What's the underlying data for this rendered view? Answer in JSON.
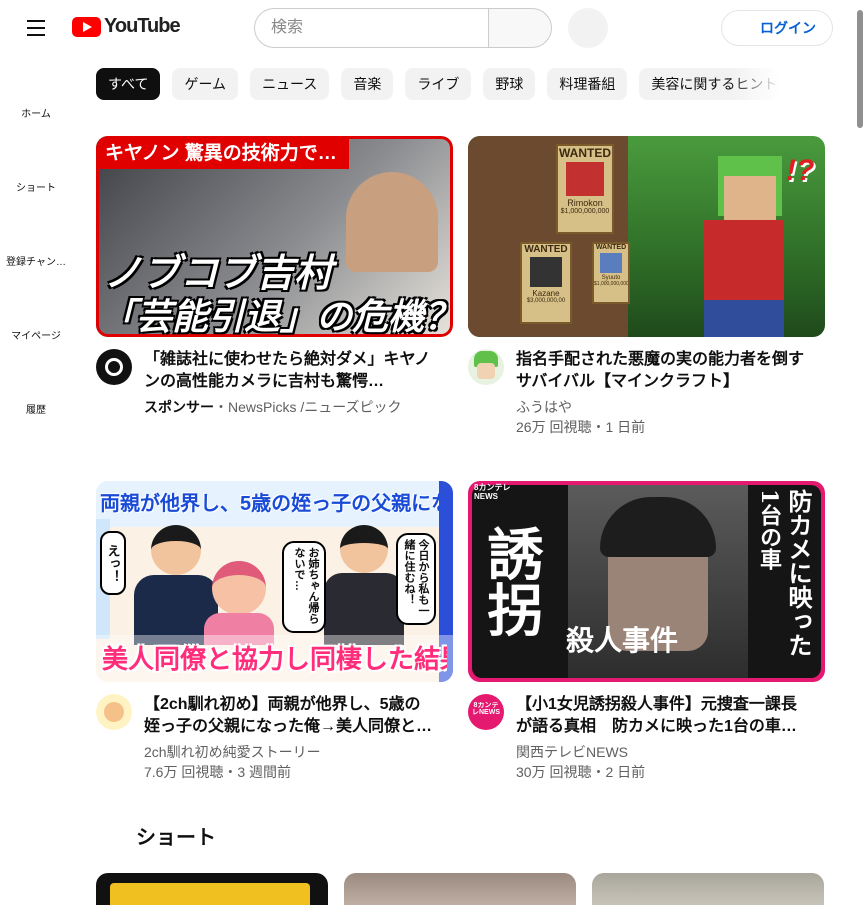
{
  "header": {
    "logo_text": "YouTube",
    "search_placeholder": "検索",
    "login_label": "ログイン"
  },
  "sidebar": {
    "items": [
      {
        "label": "ホーム"
      },
      {
        "label": "ショート"
      },
      {
        "label": "登録チャン…"
      },
      {
        "label": "マイページ"
      },
      {
        "label": "履歴"
      }
    ]
  },
  "chips": [
    "すべて",
    "ゲーム",
    "ニュース",
    "音楽",
    "ライブ",
    "野球",
    "料理番組",
    "美容に関するヒント"
  ],
  "videos": [
    {
      "title": "「雑誌社に使わせたら絶対ダメ」キヤノンの高性能カメラに吉村も驚愕…",
      "sponsor": "スポンサー",
      "channel": "・NewsPicks /ニューズピック",
      "stats": "",
      "thumb_text": [
        "キヤノン 驚異の技術力で…",
        "ノブコブ吉村",
        "「芸能引退」の危機？"
      ]
    },
    {
      "title": "指名手配された悪魔の実の能力者を倒すサバイバル【マインクラフト】",
      "channel": "ふうはや",
      "stats": "26万 回視聴・1 日前",
      "thumb_text": [
        "WANTED",
        "Rimokon",
        "$1,000,000,000",
        "WANTED",
        "Kazane",
        "$3,000,000,00",
        "WANTED",
        "Syuuto",
        "$1,000,000,000",
        "!?"
      ]
    },
    {
      "title": "【2ch馴れ初め】両親が他界し、5歳の姪っ子の父親になった俺→美人同僚と…",
      "channel": "2ch馴れ初め純愛ストーリー",
      "stats": "7.6万 回視聴・3 週間前",
      "thumb_text": [
        "両親が他界し、5歳の姪っ子の父親になった俺",
        "美人同僚と協力し同棲した結果",
        "えっ！",
        "お姉ちゃん帰らないで…",
        "今日から私も一緒に住むね！"
      ]
    },
    {
      "title": "【小1女児誘拐殺人事件】元捜査一課長が語る真相　防カメに映った1台の車…",
      "channel": "関西テレビNEWS",
      "stats": "30万 回視聴・2 日前",
      "thumb_text": [
        "誘拐",
        "殺人事件",
        "防カメに映った",
        "1台の車",
        "8カンテレNEWS"
      ]
    }
  ],
  "shorts": {
    "title": "ショート"
  },
  "colors": {
    "accent": "#ff0000",
    "link": "#065fd4",
    "chip_active": "#0f0f0f",
    "chip": "#f2f2f2"
  }
}
